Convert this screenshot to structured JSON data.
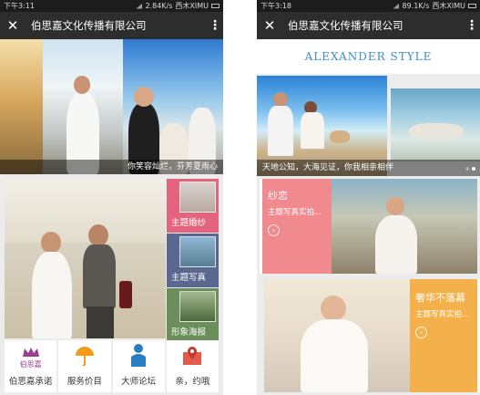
{
  "left": {
    "status": {
      "time": "下午3:11",
      "speed": "2.84K/s",
      "carrier": "西木XIMU"
    },
    "nav": {
      "title": "伯思嘉文化传播有限公司"
    },
    "hero_caption": "你笑容灿烂，芬芳夏雨心",
    "tiles": [
      {
        "label": "主题婚纱"
      },
      {
        "label": "主题写真"
      },
      {
        "label": "形象海报"
      }
    ],
    "bottom": [
      {
        "label": "伯思嘉承诺",
        "icon": "crown-logo-icon",
        "logo_text": "伯思嘉"
      },
      {
        "label": "服务价目",
        "icon": "umbrella-icon"
      },
      {
        "label": "大师论坛",
        "icon": "person-icon"
      },
      {
        "label": "亲，约哦",
        "icon": "map-pin-icon"
      }
    ],
    "colors": {
      "tile1": "#e4647e",
      "tile2": "#5a678f",
      "tile3": "#6b8f5a"
    }
  },
  "right": {
    "status": {
      "time": "下午3:18",
      "speed": "89.1K/s",
      "carrier": "西木XIMU"
    },
    "nav": {
      "title": "伯思嘉文化传播有限公司"
    },
    "brand": "ALEXANDER STYLE",
    "slide_caption": "天地公知，大海见证，你我相亲相伴",
    "cards": [
      {
        "title": "纱恋",
        "subtitle": "主题写真实拍...",
        "color": "#f08a8e"
      },
      {
        "title": "奢华不落幕",
        "subtitle": "主题写真实拍...",
        "color": "#f4b04a"
      }
    ]
  }
}
